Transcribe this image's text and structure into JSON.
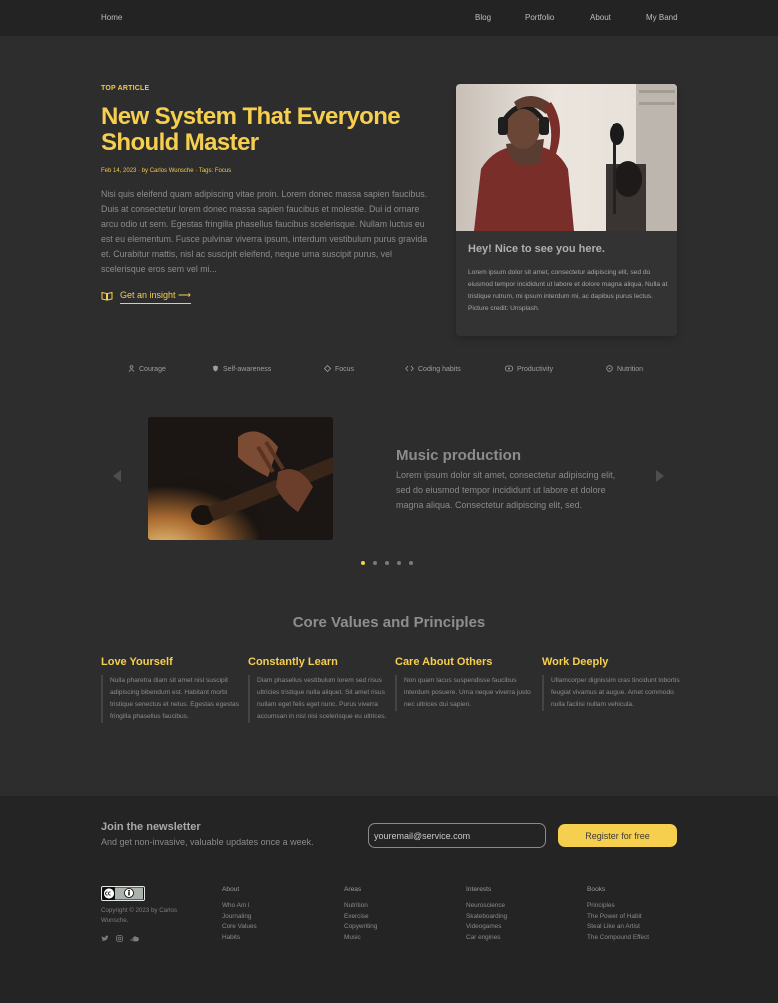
{
  "nav": {
    "home": "Home",
    "links": [
      "Blog",
      "Portfolio",
      "About",
      "My Band"
    ]
  },
  "hero": {
    "eyebrow": "TOP ARTICLE",
    "title": "New System That Everyone Should Master",
    "meta": "Feb 14, 2023 · by Carlos Wunsche · Tags: Focus",
    "body": "Nisi quis eleifend quam adipiscing vitae proin. Lorem donec massa sapien faucibus. Duis at consectetur lorem donec massa sapien faucibus et molestie. Dui id ornare arcu odio ut sem. Egestas fringilla phasellus faucibus scelerisque. Nullam luctus eu est eu elementum. Fusce pulvinar viverra ipsum, interdum vestibulum purus gravida et. Curabitur mattis, nisl ac suscipit eleifend, neque urna suscipit purus, vel scelerisque eros sem vel mi...",
    "cta": "Get an insight ⟶"
  },
  "card": {
    "title": "Hey! Nice to see you here.",
    "text": "Lorem ipsum dolor sit amet, consectetur adipiscing elit, sed do eiusmod tempor incididunt ut labore et dolore magna aliqua. Nulla at tristique rutrum, mi ipsum interdum mi, ac dapibus purus lectus.",
    "credit": "Picture credit: Unsplash."
  },
  "tags": [
    {
      "label": "Courage",
      "icon": "person-icon"
    },
    {
      "label": "Self-awareness",
      "icon": "shield-icon"
    },
    {
      "label": "Focus",
      "icon": "diamond-icon"
    },
    {
      "label": "Coding habits",
      "icon": "code-icon"
    },
    {
      "label": "Productivity",
      "icon": "clock-icon"
    },
    {
      "label": "Nutrition",
      "icon": "apple-icon"
    }
  ],
  "slider": {
    "title": "Music production",
    "text": "Lorem ipsum dolor sit amet, consectetur adipiscing elit, sed do eiusmod tempor incididunt ut labore et dolore magna aliqua. Consectetur adipiscing elit, sed.",
    "dot_count": 5,
    "active_dot": 1
  },
  "values": {
    "title": "Core Values and Principles",
    "items": [
      {
        "title": "Love Yourself",
        "text": "Nulla pharetra diam sit amet nisl suscipit adipiscing bibendum est. Habitant morbi tristique senectus et netus. Egestas egestas fringilla phasellus faucibus."
      },
      {
        "title": "Constantly Learn",
        "text": "Diam phasellus vestibulum lorem sed risus ultricies tristique nulla aliquet. Sit amet risus nullam eget felis eget nunc. Purus viverra accumsan in nisl nisi scelerisque eu ultrices."
      },
      {
        "title": "Care About Others",
        "text": "Non quam lacus suspendisse faucibus interdum posuere. Urna neque viverra justo nec ultrices dui sapien."
      },
      {
        "title": "Work Deeply",
        "text": "Ullamcorper dignissim cras tincidunt lobortis feugiat vivamus at augue. Amet commodo nulla facilisi nullam vehicula."
      }
    ]
  },
  "newsletter": {
    "title": "Join the newsletter",
    "subtitle": "And get non-invasive, valuable updates once a week.",
    "email_value": "youremail@service.com",
    "button": "Register for free"
  },
  "footer": {
    "copyright": "Copyright © 2023 by Carlos Wunsche.",
    "socials": [
      "twitter-icon",
      "instagram-icon",
      "soundcloud-icon"
    ],
    "columns": [
      {
        "title": "About",
        "items": [
          "Who Am I",
          "Journaling",
          "Core Values",
          "Habits"
        ]
      },
      {
        "title": "Areas",
        "items": [
          "Nutrition",
          "Exercise",
          "Copywriting",
          "Music"
        ]
      },
      {
        "title": "Interests",
        "items": [
          "Neuroscience",
          "Skateboarding",
          "Videogames",
          "Car engines"
        ]
      },
      {
        "title": "Books",
        "items": [
          "Principles",
          "The Power of Habit",
          "Steal Like an Artist",
          "The Compound Effect"
        ]
      }
    ]
  }
}
